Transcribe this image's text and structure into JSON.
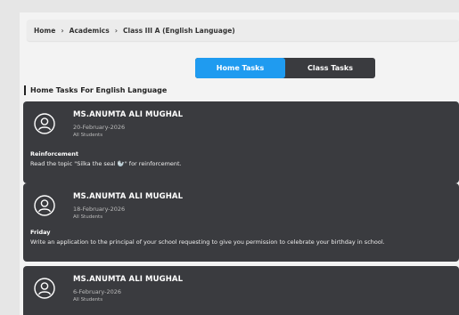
{
  "breadcrumb": [
    "Home",
    "Academics",
    "Class III A (English Language)"
  ],
  "breadcrumb_separator": "›",
  "tabs": [
    {
      "label": "Home Tasks",
      "active": true
    },
    {
      "label": "Class Tasks",
      "active": false
    }
  ],
  "section_title": "Home Tasks For English Language",
  "colors": {
    "card": "#3a3b3f",
    "active_tab": "#1f9bf0"
  },
  "posts": [
    {
      "teacher": "MS.ANUMTA ALI MUGHAL",
      "date": "20-February-2026",
      "audience": "All Students",
      "title": "Reinforcement",
      "body": "Read the topic \"Silka the seal 🦭\" for reinforcement."
    },
    {
      "teacher": "MS.ANUMTA ALI MUGHAL",
      "date": "18-February-2026",
      "audience": "All Students",
      "title": "Friday",
      "body": "Write an application to the principal of your school requesting to give you permission to celebrate your birthday in school."
    },
    {
      "teacher": "MS.ANUMTA ALI MUGHAL",
      "date": "6-February-2026",
      "audience": "All Students",
      "title": "",
      "body": ""
    }
  ]
}
